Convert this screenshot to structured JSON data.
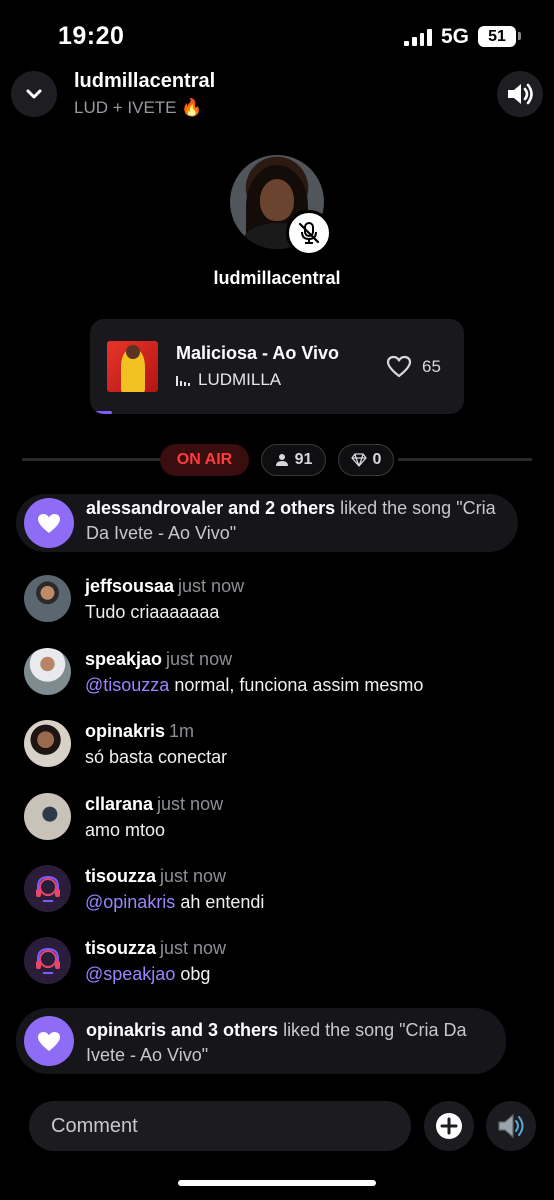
{
  "status_bar": {
    "time": "19:20",
    "network": "5G",
    "battery": "51"
  },
  "header": {
    "room_name": "ludmillacentral",
    "room_subtitle": "LUD + IVETE 🔥"
  },
  "host": {
    "name": "ludmillacentral"
  },
  "now_playing": {
    "title": "Maliciosa - Ao Vivo",
    "artist": "LUDMILLA",
    "likes": "65",
    "progress_fraction": 0.06
  },
  "stats": {
    "on_air": "ON AIR",
    "listeners": "91",
    "diamonds": "0"
  },
  "feed": {
    "notice_1": {
      "actors": "alessandrovaler and 2 others",
      "text": " liked the song \"Cria Da Ivete - Ao Vivo\""
    },
    "comments": [
      {
        "user": "jeffsousaa",
        "time": "just now",
        "mention": "",
        "text": "Tudo criaaaaaaa"
      },
      {
        "user": "speakjao",
        "time": "just now",
        "mention": "@tisouzza",
        "text": " normal, funciona assim mesmo"
      },
      {
        "user": "opinakris",
        "time": "1m",
        "mention": "",
        "text": "só basta conectar"
      },
      {
        "user": "cllarana",
        "time": "just now",
        "mention": "",
        "text": "amo mtoo"
      },
      {
        "user": "tisouzza",
        "time": "just now",
        "mention": "@opinakris",
        "text": " ah entendi"
      },
      {
        "user": "tisouzza",
        "time": "just now",
        "mention": "@speakjao",
        "text": " obg"
      }
    ],
    "notice_2": {
      "actors": "opinakris and 3 others",
      "text": " liked the song \"Cria Da Ivete - Ao Vivo\""
    }
  },
  "composer": {
    "placeholder": "Comment"
  },
  "icons": {
    "collapse": "chevron-down-icon",
    "volume": "volume-icon",
    "mic_muted": "mic-off-icon",
    "heart": "heart-icon",
    "listeners": "person-icon",
    "diamond": "diamond-icon",
    "add": "plus-circle-icon",
    "speaker": "speaker-icon"
  },
  "colors": {
    "accent": "#8e6cf5",
    "mention": "#9d84ff",
    "on_air": "#ff3b3b"
  }
}
